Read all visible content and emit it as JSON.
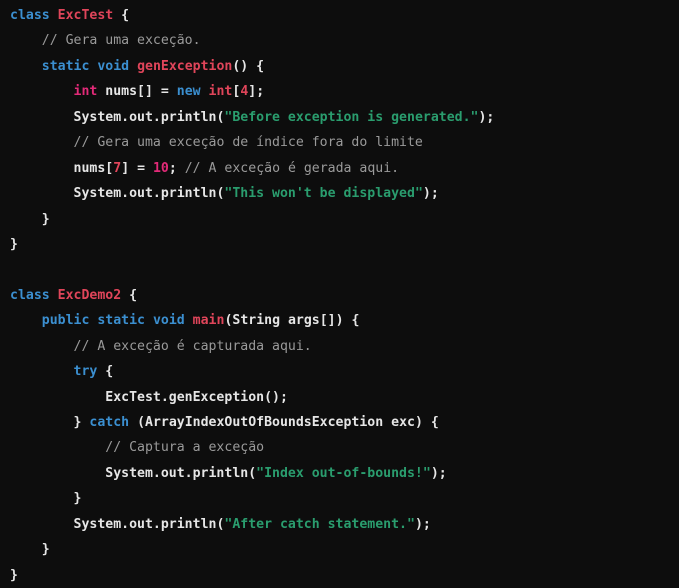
{
  "editor": {
    "language": "java",
    "theme": {
      "background": "#0d0d0d",
      "foreground": "#e6e6e6",
      "keyword": "#3b8fd0",
      "class_name": "#e0455a",
      "primitive": "#e22a78",
      "string": "#2a9d6e",
      "comment": "#9a9a9a"
    }
  },
  "code": {
    "lines": [
      {
        "n": 1,
        "indent": 0,
        "tokens": [
          {
            "t": "class",
            "c": "kw"
          },
          {
            "t": " ",
            "c": "pl"
          },
          {
            "t": "ExcTest",
            "c": "type"
          },
          {
            "t": " {",
            "c": "pl"
          }
        ]
      },
      {
        "n": 2,
        "indent": 1,
        "tokens": [
          {
            "t": "// Gera uma exceção.",
            "c": "cmt"
          }
        ]
      },
      {
        "n": 3,
        "indent": 1,
        "tokens": [
          {
            "t": "static",
            "c": "kw"
          },
          {
            "t": " ",
            "c": "pl"
          },
          {
            "t": "void",
            "c": "kw"
          },
          {
            "t": " ",
            "c": "pl"
          },
          {
            "t": "genException",
            "c": "type"
          },
          {
            "t": "() {",
            "c": "pl"
          }
        ]
      },
      {
        "n": 4,
        "indent": 2,
        "tokens": [
          {
            "t": "int",
            "c": "prim"
          },
          {
            "t": " nums[] = ",
            "c": "pl"
          },
          {
            "t": "new",
            "c": "kw"
          },
          {
            "t": " ",
            "c": "pl"
          },
          {
            "t": "int",
            "c": "type"
          },
          {
            "t": "[",
            "c": "pl"
          },
          {
            "t": "4",
            "c": "type"
          },
          {
            "t": "];",
            "c": "pl"
          }
        ]
      },
      {
        "n": 5,
        "indent": 2,
        "tokens": [
          {
            "t": "System.out.println(",
            "c": "pl"
          },
          {
            "t": "\"Before exception is generated.\"",
            "c": "str"
          },
          {
            "t": ");",
            "c": "pl"
          }
        ]
      },
      {
        "n": 6,
        "indent": 2,
        "tokens": [
          {
            "t": "// Gera uma exceção de índice fora do limite",
            "c": "cmt"
          }
        ]
      },
      {
        "n": 7,
        "indent": 2,
        "tokens": [
          {
            "t": "nums[",
            "c": "pl"
          },
          {
            "t": "7",
            "c": "type"
          },
          {
            "t": "] = ",
            "c": "pl"
          },
          {
            "t": "10",
            "c": "prim"
          },
          {
            "t": "; ",
            "c": "pl"
          },
          {
            "t": "// A exceção é gerada aqui.",
            "c": "cmt"
          }
        ]
      },
      {
        "n": 8,
        "indent": 2,
        "tokens": [
          {
            "t": "System.out.println(",
            "c": "pl"
          },
          {
            "t": "\"This won't be displayed\"",
            "c": "str"
          },
          {
            "t": ");",
            "c": "pl"
          }
        ]
      },
      {
        "n": 9,
        "indent": 1,
        "tokens": [
          {
            "t": "}",
            "c": "pl"
          }
        ]
      },
      {
        "n": 10,
        "indent": 0,
        "tokens": [
          {
            "t": "}",
            "c": "pl"
          }
        ]
      },
      {
        "n": 11,
        "indent": 0,
        "tokens": []
      },
      {
        "n": 12,
        "indent": 0,
        "tokens": [
          {
            "t": "class",
            "c": "kw"
          },
          {
            "t": " ",
            "c": "pl"
          },
          {
            "t": "ExcDemo2",
            "c": "type"
          },
          {
            "t": " {",
            "c": "pl"
          }
        ]
      },
      {
        "n": 13,
        "indent": 1,
        "tokens": [
          {
            "t": "public",
            "c": "kw"
          },
          {
            "t": " ",
            "c": "pl"
          },
          {
            "t": "static",
            "c": "kw"
          },
          {
            "t": " ",
            "c": "pl"
          },
          {
            "t": "void",
            "c": "kw"
          },
          {
            "t": " ",
            "c": "pl"
          },
          {
            "t": "main",
            "c": "type"
          },
          {
            "t": "(String args[]) {",
            "c": "pl"
          }
        ]
      },
      {
        "n": 14,
        "indent": 2,
        "tokens": [
          {
            "t": "// A exceção é capturada aqui.",
            "c": "cmt"
          }
        ]
      },
      {
        "n": 15,
        "indent": 2,
        "tokens": [
          {
            "t": "try",
            "c": "kw"
          },
          {
            "t": " {",
            "c": "pl"
          }
        ]
      },
      {
        "n": 16,
        "indent": 3,
        "tokens": [
          {
            "t": "ExcTest.genException();",
            "c": "pl"
          }
        ]
      },
      {
        "n": 17,
        "indent": 2,
        "tokens": [
          {
            "t": "} ",
            "c": "pl"
          },
          {
            "t": "catch",
            "c": "kw"
          },
          {
            "t": " (ArrayIndexOutOfBoundsException exc) {",
            "c": "pl"
          }
        ]
      },
      {
        "n": 18,
        "indent": 3,
        "tokens": [
          {
            "t": "// Captura a exceção",
            "c": "cmt"
          }
        ]
      },
      {
        "n": 19,
        "indent": 3,
        "tokens": [
          {
            "t": "System.out.println(",
            "c": "pl"
          },
          {
            "t": "\"Index out-of-bounds!\"",
            "c": "str"
          },
          {
            "t": ");",
            "c": "pl"
          }
        ]
      },
      {
        "n": 20,
        "indent": 2,
        "tokens": [
          {
            "t": "}",
            "c": "pl"
          }
        ]
      },
      {
        "n": 21,
        "indent": 2,
        "tokens": [
          {
            "t": "System.out.println(",
            "c": "pl"
          },
          {
            "t": "\"After catch statement.\"",
            "c": "str"
          },
          {
            "t": ");",
            "c": "pl"
          }
        ]
      },
      {
        "n": 22,
        "indent": 1,
        "tokens": [
          {
            "t": "}",
            "c": "pl"
          }
        ]
      },
      {
        "n": 23,
        "indent": 0,
        "tokens": [
          {
            "t": "}",
            "c": "pl"
          }
        ]
      }
    ]
  }
}
